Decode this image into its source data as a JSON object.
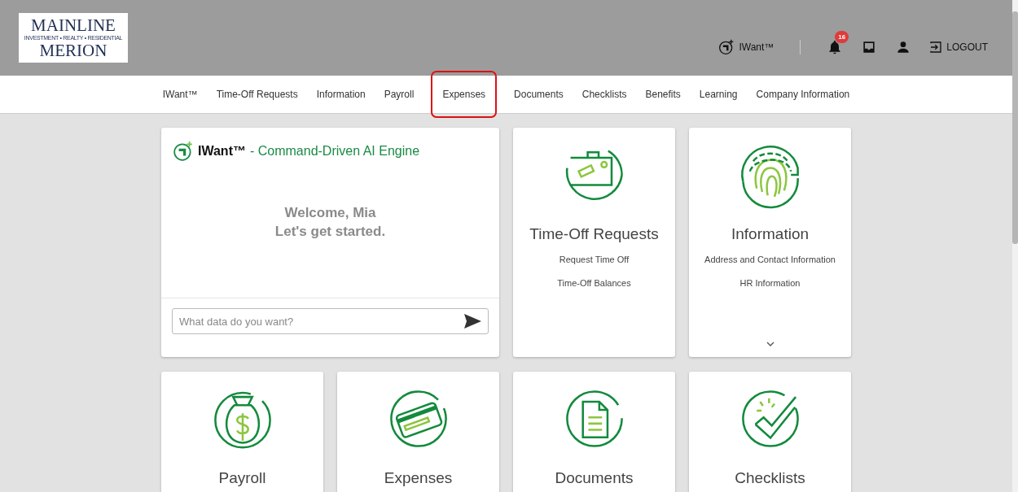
{
  "logo": {
    "line1": "MAINLINE",
    "tagline": "INVESTMENT • REALTY • RESIDENTIAL",
    "line2": "MERION"
  },
  "header": {
    "iwant_label": "IWant™",
    "notification_count": "16",
    "logout_label": "LOGOUT"
  },
  "nav": [
    {
      "label": "IWant™",
      "highlighted": false
    },
    {
      "label": "Time-Off Requests",
      "highlighted": false
    },
    {
      "label": "Information",
      "highlighted": false
    },
    {
      "label": "Payroll",
      "highlighted": false
    },
    {
      "label": "Expenses",
      "highlighted": true
    },
    {
      "label": "Documents",
      "highlighted": false
    },
    {
      "label": "Checklists",
      "highlighted": false
    },
    {
      "label": "Benefits",
      "highlighted": false
    },
    {
      "label": "Learning",
      "highlighted": false
    },
    {
      "label": "Company Information",
      "highlighted": false
    }
  ],
  "iwant_card": {
    "title": "IWant™",
    "subtitle": "- Command-Driven AI Engine",
    "welcome": "Welcome, Mia",
    "prompt": "Let's get started.",
    "placeholder": "What data do you want?"
  },
  "tiles": [
    {
      "kind": "briefcase",
      "title": "Time-Off Requests",
      "links": [
        "Request Time Off",
        "Time-Off Balances"
      ],
      "expandable": false
    },
    {
      "kind": "fingerprint",
      "title": "Information",
      "links": [
        "Address and Contact Information",
        "HR Information"
      ],
      "expandable": true
    },
    {
      "kind": "money-bag",
      "title": "Payroll"
    },
    {
      "kind": "card",
      "title": "Expenses"
    },
    {
      "kind": "document",
      "title": "Documents"
    },
    {
      "kind": "checklist",
      "title": "Checklists"
    }
  ]
}
